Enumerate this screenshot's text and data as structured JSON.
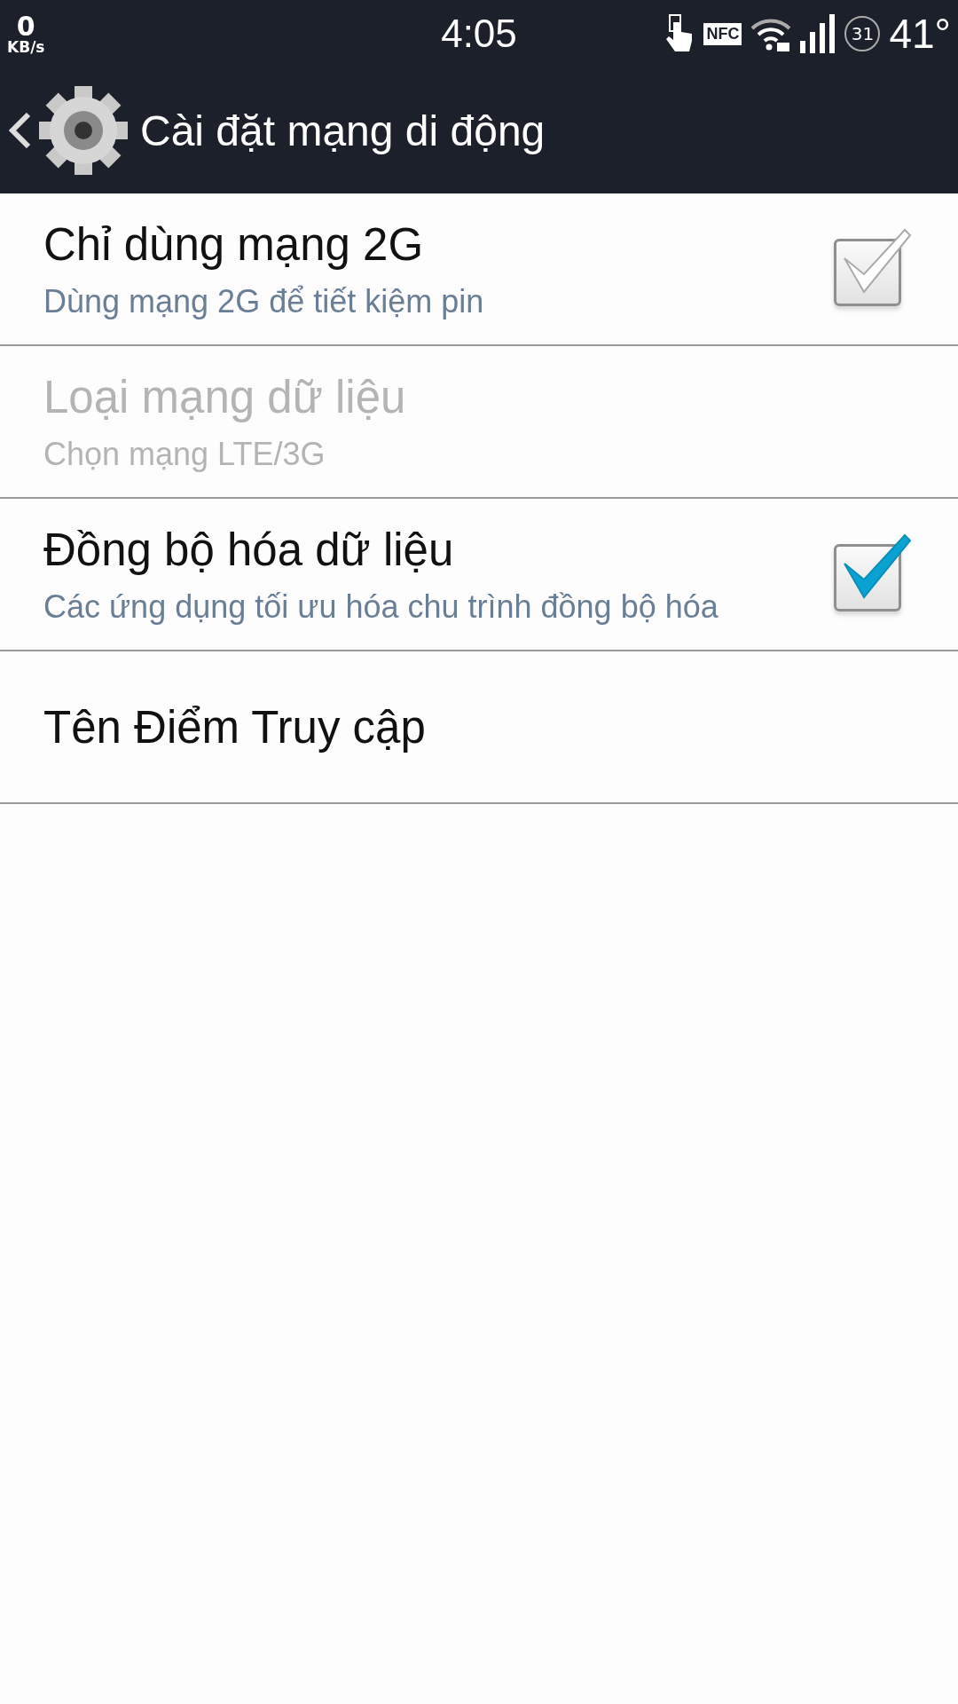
{
  "status_bar": {
    "speed": "0",
    "speed_unit": "KB/s",
    "time": "4:05",
    "nfc": "NFC",
    "battery": "31",
    "temperature": "41°"
  },
  "header": {
    "title": "Cài đặt mạng di động"
  },
  "items": [
    {
      "kind": "checkbox",
      "title": "Chỉ dùng mạng 2G",
      "subtitle": "Dùng mạng 2G để tiết kiệm pin",
      "disabled": false,
      "checked": false
    },
    {
      "kind": "plain",
      "title": "Loại mạng dữ liệu",
      "subtitle": "Chọn mạng LTE/3G",
      "disabled": true
    },
    {
      "kind": "checkbox",
      "title": "Đồng bộ hóa dữ liệu",
      "subtitle": "Các ứng dụng tối ưu hóa chu trình đồng bộ hóa",
      "disabled": false,
      "checked": true
    },
    {
      "kind": "plain",
      "title": "Tên Điểm Truy cập",
      "disabled": false
    }
  ]
}
